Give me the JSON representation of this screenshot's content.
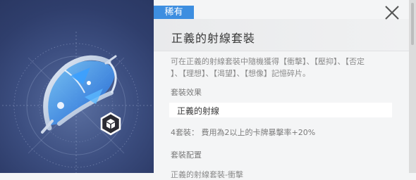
{
  "item": {
    "rarity": "稀有",
    "title": "正義的射線套裝",
    "description_lines": [
      "可在正義的射線套裝中隨機獲得【衝擊】、【壓抑】、【否定",
      "】、【理想】、【渴望】、【想像】記憶碎片。"
    ],
    "effect_label": "套裝效果",
    "set_name": "正義的射線",
    "effect_text": "4套裝：  費用為2以上的卡牌暴擊率+20%",
    "config_label": "套裝配置",
    "config_first_row": "正義的射線套裝-衝擊"
  },
  "icons": {
    "close": "close-x-icon",
    "item_type": "cube-emblem-icon",
    "item_art": "bow-weapon-illustration"
  },
  "colors": {
    "rarity_bg": "#3d8ee0",
    "art_bg": "#3c4e80",
    "panel_bg": "#f4f5f6"
  }
}
